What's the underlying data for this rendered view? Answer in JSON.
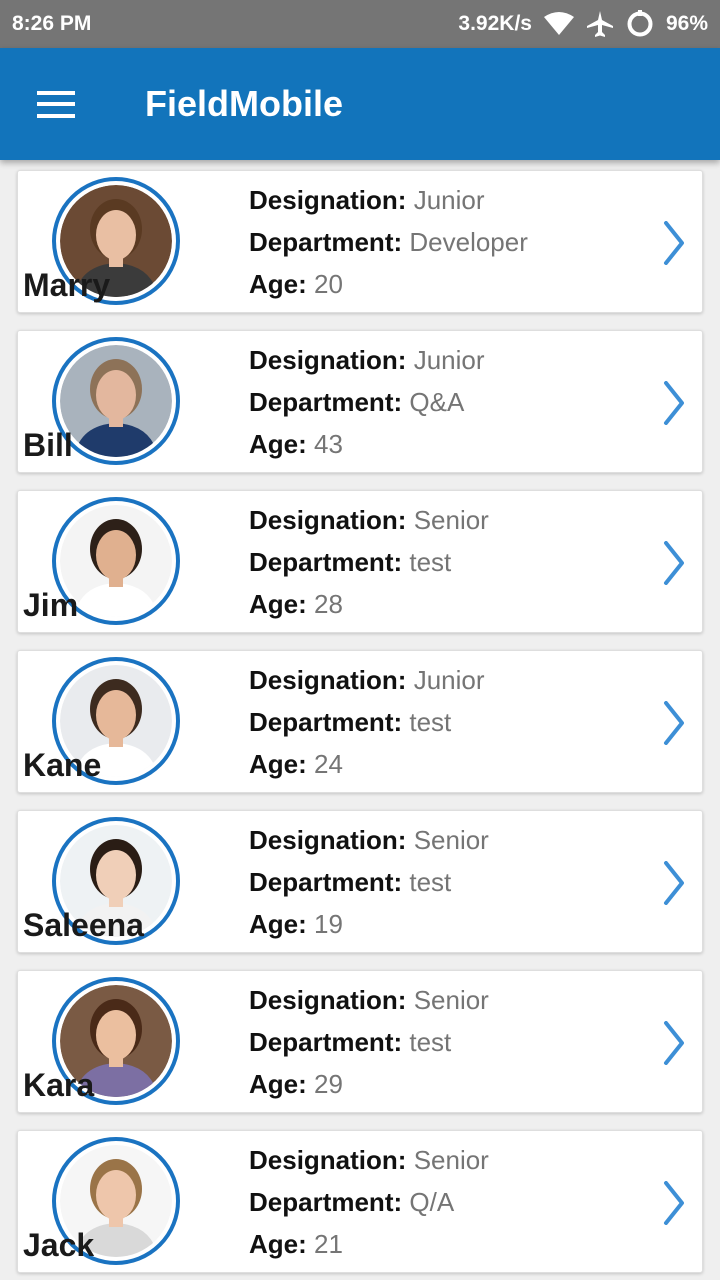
{
  "status_bar": {
    "time": "8:26 PM",
    "net_speed": "3.92K/s",
    "battery": "96%",
    "icons": [
      "wifi-icon",
      "airplane-icon",
      "sync-icon"
    ]
  },
  "app_bar": {
    "title": "FieldMobile",
    "menu_icon": "hamburger-menu-icon"
  },
  "labels": {
    "designation": "Designation:",
    "department": "Department:",
    "age": "Age:"
  },
  "employees": [
    {
      "name": "Marry",
      "designation": "Junior",
      "department": "Developer",
      "age": "20"
    },
    {
      "name": "Bill",
      "designation": "Junior",
      "department": "Q&A",
      "age": "43"
    },
    {
      "name": "Jim",
      "designation": "Senior",
      "department": "test",
      "age": "28"
    },
    {
      "name": "Kane",
      "designation": "Junior",
      "department": "test",
      "age": "24"
    },
    {
      "name": "Saleena",
      "designation": "Senior",
      "department": "test",
      "age": "19"
    },
    {
      "name": "Kara",
      "designation": "Senior",
      "department": "test",
      "age": "29"
    },
    {
      "name": "Jack",
      "designation": "Senior",
      "department": "Q/A",
      "age": "21"
    }
  ],
  "colors": {
    "primary": "#1274bb",
    "status_bar": "#757575",
    "accent": "#1a73c1"
  }
}
